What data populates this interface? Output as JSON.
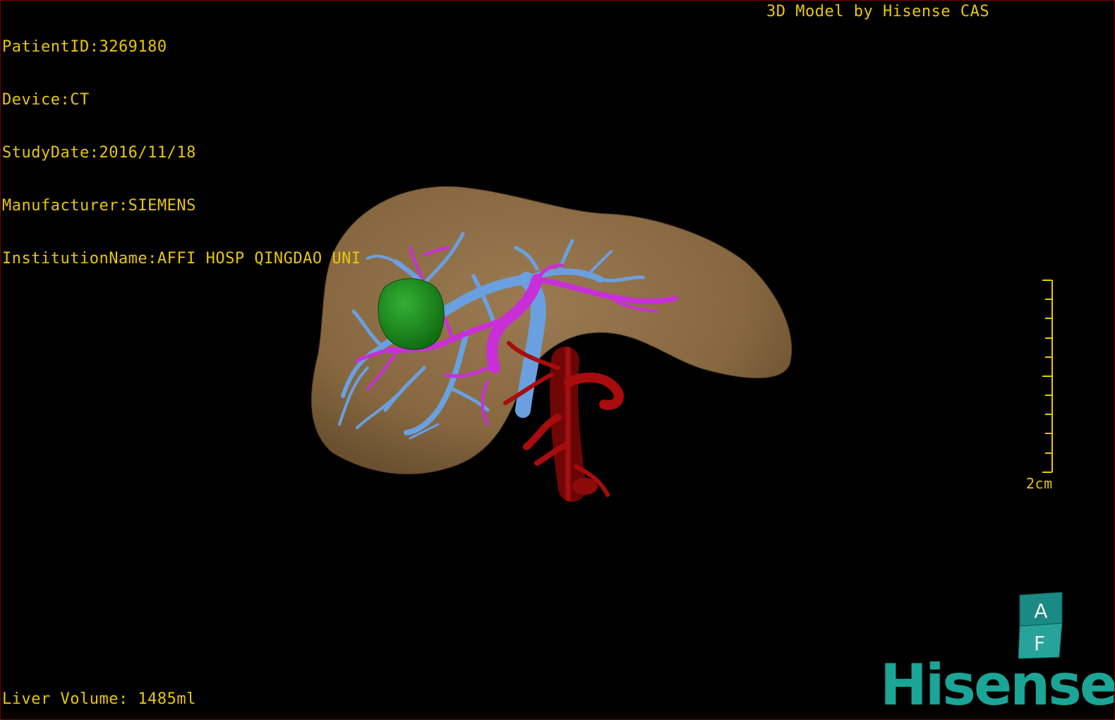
{
  "info": {
    "patient_id": "PatientID:3269180",
    "device": "Device:CT",
    "study_date": "StudyDate:2016/11/18",
    "manufacturer": "Manufacturer:SIEMENS",
    "institution": "InstitutionName:AFFI HOSP QINGDAO UNI"
  },
  "caption": "3D Model by Hisense CAS",
  "liver_volume": "Liver Volume: 1485ml",
  "scale_bar": {
    "label": "2cm"
  },
  "orientation_cube": {
    "top_label": "A",
    "front_label": "F"
  },
  "logo": {
    "text": "Hisense"
  },
  "colors": {
    "overlay_text": "#e8c60a",
    "liver": "#8a6a45",
    "portal_vein": "#6aa0e0",
    "hepatic_artery": "#c82fd8",
    "tumor": "#1f8f1f",
    "aorta": "#a80c0c",
    "logo": "#1aa596",
    "frame": "#7a0000"
  },
  "icons": {
    "orientation_cube": "orientation-cube-icon",
    "logo": "hisense-logo"
  }
}
